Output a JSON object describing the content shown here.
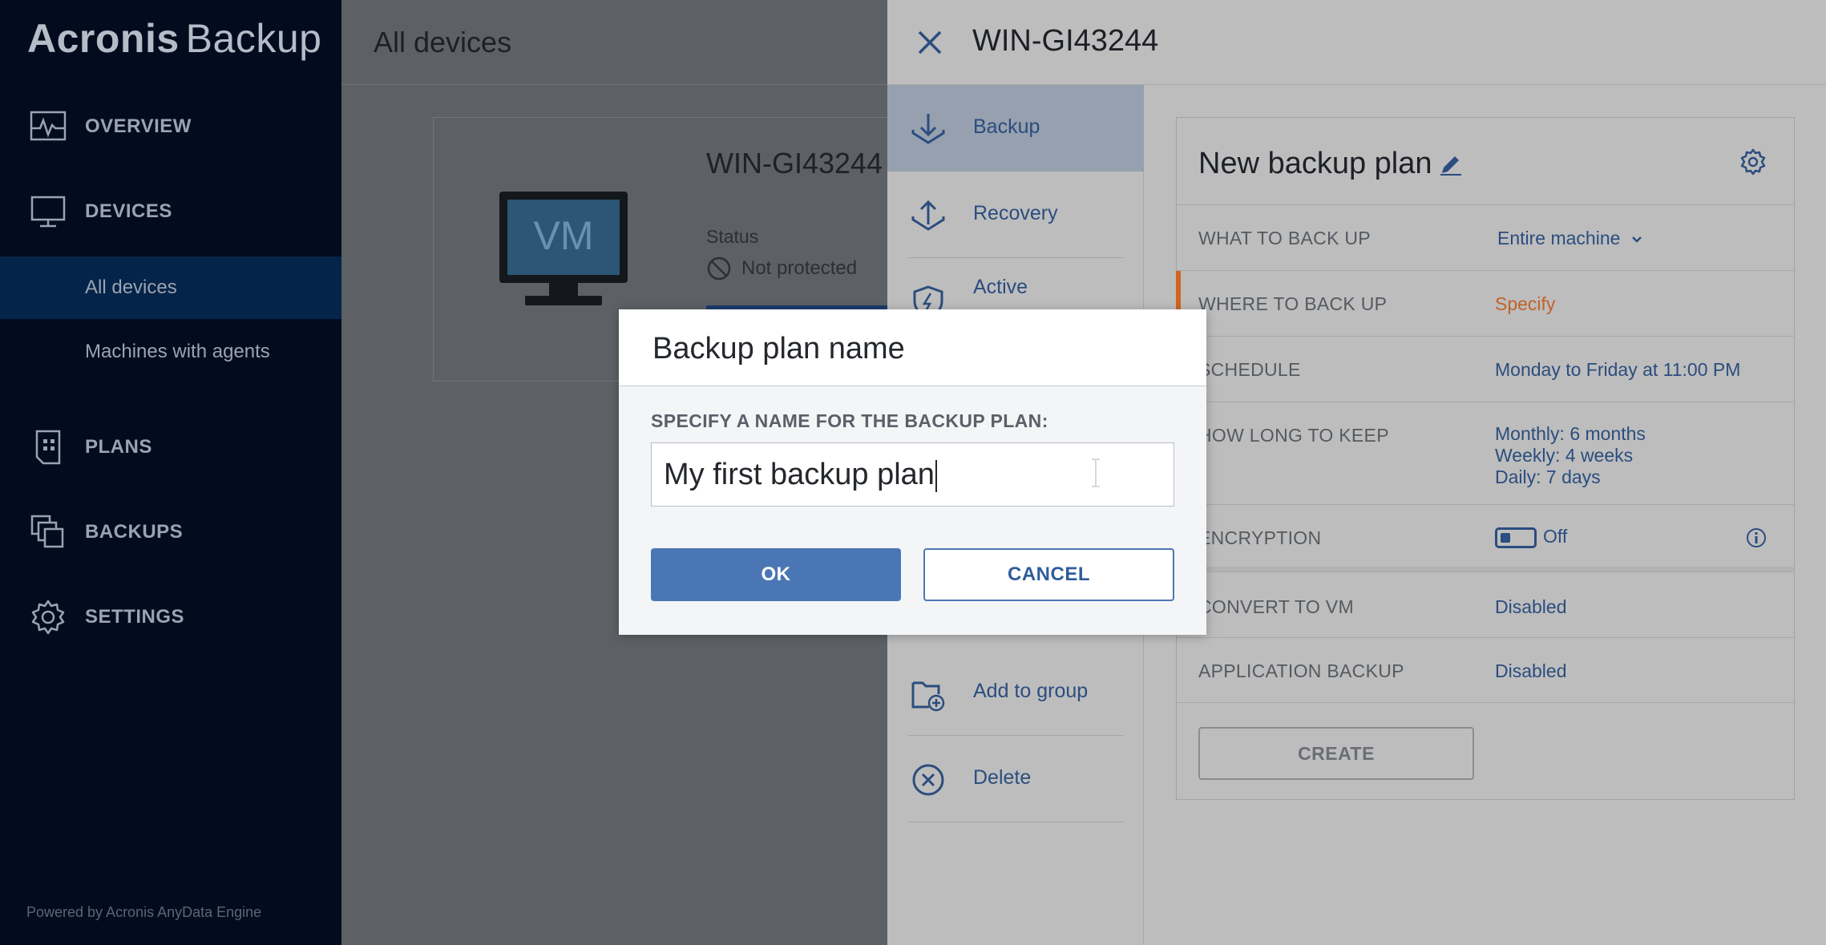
{
  "app": {
    "brand": "Acronis",
    "product": "Backup",
    "footer": "Powered by Acronis AnyData Engine"
  },
  "sidebar": {
    "items": [
      {
        "label": "OVERVIEW",
        "icon": "overview-icon"
      },
      {
        "label": "DEVICES",
        "icon": "monitor-icon"
      },
      {
        "label": "PLANS",
        "icon": "plans-icon"
      },
      {
        "label": "BACKUPS",
        "icon": "backups-icon"
      },
      {
        "label": "SETTINGS",
        "icon": "gear-icon"
      }
    ],
    "subitems": [
      {
        "label": "All devices",
        "active": true
      },
      {
        "label": "Machines with agents",
        "active": false
      }
    ]
  },
  "main": {
    "title": "All devices",
    "card": {
      "name": "WIN-GI43244",
      "vm_label": "VM",
      "status_label": "Status",
      "status_value": "Not protected"
    }
  },
  "panel": {
    "title": "WIN-GI43244",
    "actions": [
      {
        "label": "Backup",
        "icon": "backup-download-icon",
        "selected": true
      },
      {
        "label": "Recovery",
        "icon": "recovery-upload-icon",
        "selected": false
      },
      {
        "label": "Active",
        "icon": "active-protection-shield-icon",
        "selected": false
      },
      {
        "label": "Add to group",
        "icon": "add-to-group-icon",
        "selected": false
      },
      {
        "label": "Delete",
        "icon": "delete-circle-x-icon",
        "selected": false
      }
    ],
    "plan": {
      "title": "New backup plan",
      "rows": [
        {
          "label": "WHAT TO BACK UP",
          "value": "Entire machine"
        },
        {
          "label": "WHERE TO BACK UP",
          "value": "Specify"
        },
        {
          "label": "SCHEDULE",
          "value": "Monday to Friday at 11:00 PM"
        },
        {
          "label": "HOW LONG TO KEEP",
          "value_lines": [
            "Monthly: 6 months",
            "Weekly: 4 weeks",
            "Daily: 7 days"
          ]
        },
        {
          "label": "ENCRYPTION",
          "value": "Off"
        },
        {
          "label": "CONVERT TO VM",
          "value": "Disabled"
        },
        {
          "label": "APPLICATION BACKUP",
          "value": "Disabled"
        }
      ],
      "create_label": "CREATE"
    }
  },
  "modal": {
    "title": "Backup plan name",
    "field_label": "SPECIFY A NAME FOR THE BACKUP PLAN:",
    "input_value": "My first backup plan",
    "ok_label": "OK",
    "cancel_label": "CANCEL"
  },
  "colors": {
    "sidebar_bg": "#020c1e",
    "accent_blue": "#4b76b5",
    "link_blue": "#2b4d7f",
    "warning_orange": "#d0651f"
  }
}
